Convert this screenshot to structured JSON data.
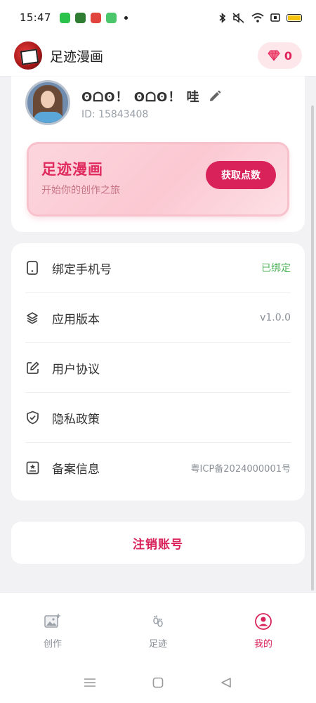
{
  "status": {
    "time": "15:47",
    "colors": {
      "battery": "#f4c20d"
    }
  },
  "appbar": {
    "title": "足迹漫画",
    "points": "0"
  },
  "profile": {
    "nickname": "ʘᗝʘ！ ʘᗝʘ！ 哇",
    "user_id": "ID: 15843408"
  },
  "banner": {
    "title": "足迹漫画",
    "subtitle": "开始你的创作之旅",
    "button_label": "获取点数"
  },
  "settings": {
    "items": [
      {
        "icon": "phone-icon",
        "label": "绑定手机号",
        "value": "已绑定"
      },
      {
        "icon": "layers-icon",
        "label": "应用版本",
        "value": "v1.0.0"
      },
      {
        "icon": "edit-document-icon",
        "label": "用户协议",
        "value": ""
      },
      {
        "icon": "shield-check-icon",
        "label": "隐私政策",
        "value": ""
      },
      {
        "icon": "certificate-icon",
        "label": "备案信息",
        "value": "粤ICP备2024000001号"
      }
    ]
  },
  "deactivate_label": "注销账号",
  "tabs": [
    {
      "icon": "image-add-icon",
      "label": "创作",
      "active": false
    },
    {
      "icon": "footprint-icon",
      "label": "足迹",
      "active": false
    },
    {
      "icon": "user-circle-icon",
      "label": "我的",
      "active": true
    }
  ],
  "colors": {
    "accent": "#d9225a",
    "bound": "#4fb35a"
  }
}
